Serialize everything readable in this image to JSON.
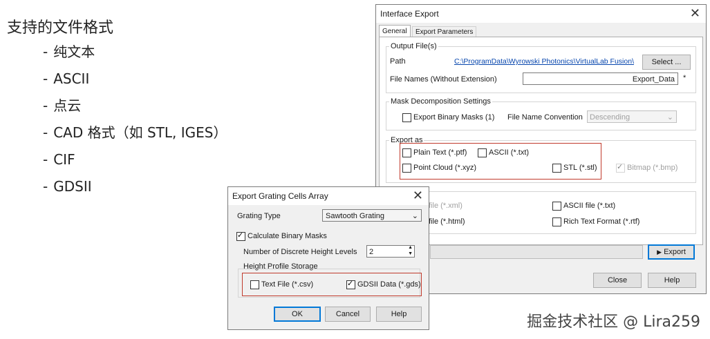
{
  "left_text": {
    "heading": "支持的文件格式",
    "items": [
      {
        "dash": "-",
        "label": "纯文本"
      },
      {
        "dash": "-",
        "label": "ASCII"
      },
      {
        "dash": "-",
        "label": "点云"
      },
      {
        "dash": "-",
        "label": "CAD 格式（如 STL, IGES）"
      },
      {
        "dash": "-",
        "label": "CIF"
      },
      {
        "dash": "-",
        "label": "GDSII"
      }
    ]
  },
  "interface_export": {
    "title": "Interface Export",
    "tabs": [
      "General",
      "Export Parameters"
    ],
    "output_files": {
      "legend": "Output File(s)",
      "path_label": "Path",
      "path_value": "C:\\ProgramData\\Wyrowski Photonics\\VirtualLab Fusion\\",
      "select_button": "Select ...",
      "file_names_label": "File Names (Without Extension)",
      "file_names_value": "Export_Data"
    },
    "mask": {
      "legend": "Mask Decomposition Settings",
      "export_binary_masks": "Export Binary Masks (1)",
      "file_name_convention_label": "File Name Convention",
      "file_name_convention_value": "Descending"
    },
    "export_as": {
      "legend": "Export as",
      "plain_text": "Plain Text (*.ptf)",
      "ascii": "ASCII (*.txt)",
      "point_cloud": "Point Cloud (*.xyz)",
      "stl": "STL (*.stl)",
      "bitmap": "Bitmap (*.bmp)"
    },
    "reports": {
      "xml": "file (*.xml)",
      "html": "file (*.html)",
      "ascii_file": "ASCII file (*.txt)",
      "rich_text": "Rich Text Format (*.rtf)"
    },
    "export_button": "Export",
    "close_button": "Close",
    "help_button": "Help"
  },
  "grating_export": {
    "title": "Export Grating Cells Array",
    "grating_type_label": "Grating Type",
    "grating_type_value": "Sawtooth Grating",
    "calc_binary_masks": "Calculate Binary Masks",
    "discrete_levels_label": "Number of Discrete Height Levels",
    "discrete_levels_value": "2",
    "height_profile_legend": "Height Profile Storage",
    "text_file": "Text File (*.csv)",
    "gdsii": "GDSII Data (*.gds)",
    "ok": "OK",
    "cancel": "Cancel",
    "help": "Help"
  },
  "watermark": "掘金技术社区 @ Lira259",
  "colors": {
    "highlight_box": "#c0392b",
    "dialog_bg": "#f0f0f0",
    "link": "#0645ad",
    "default_button_border": "#0078d7"
  }
}
